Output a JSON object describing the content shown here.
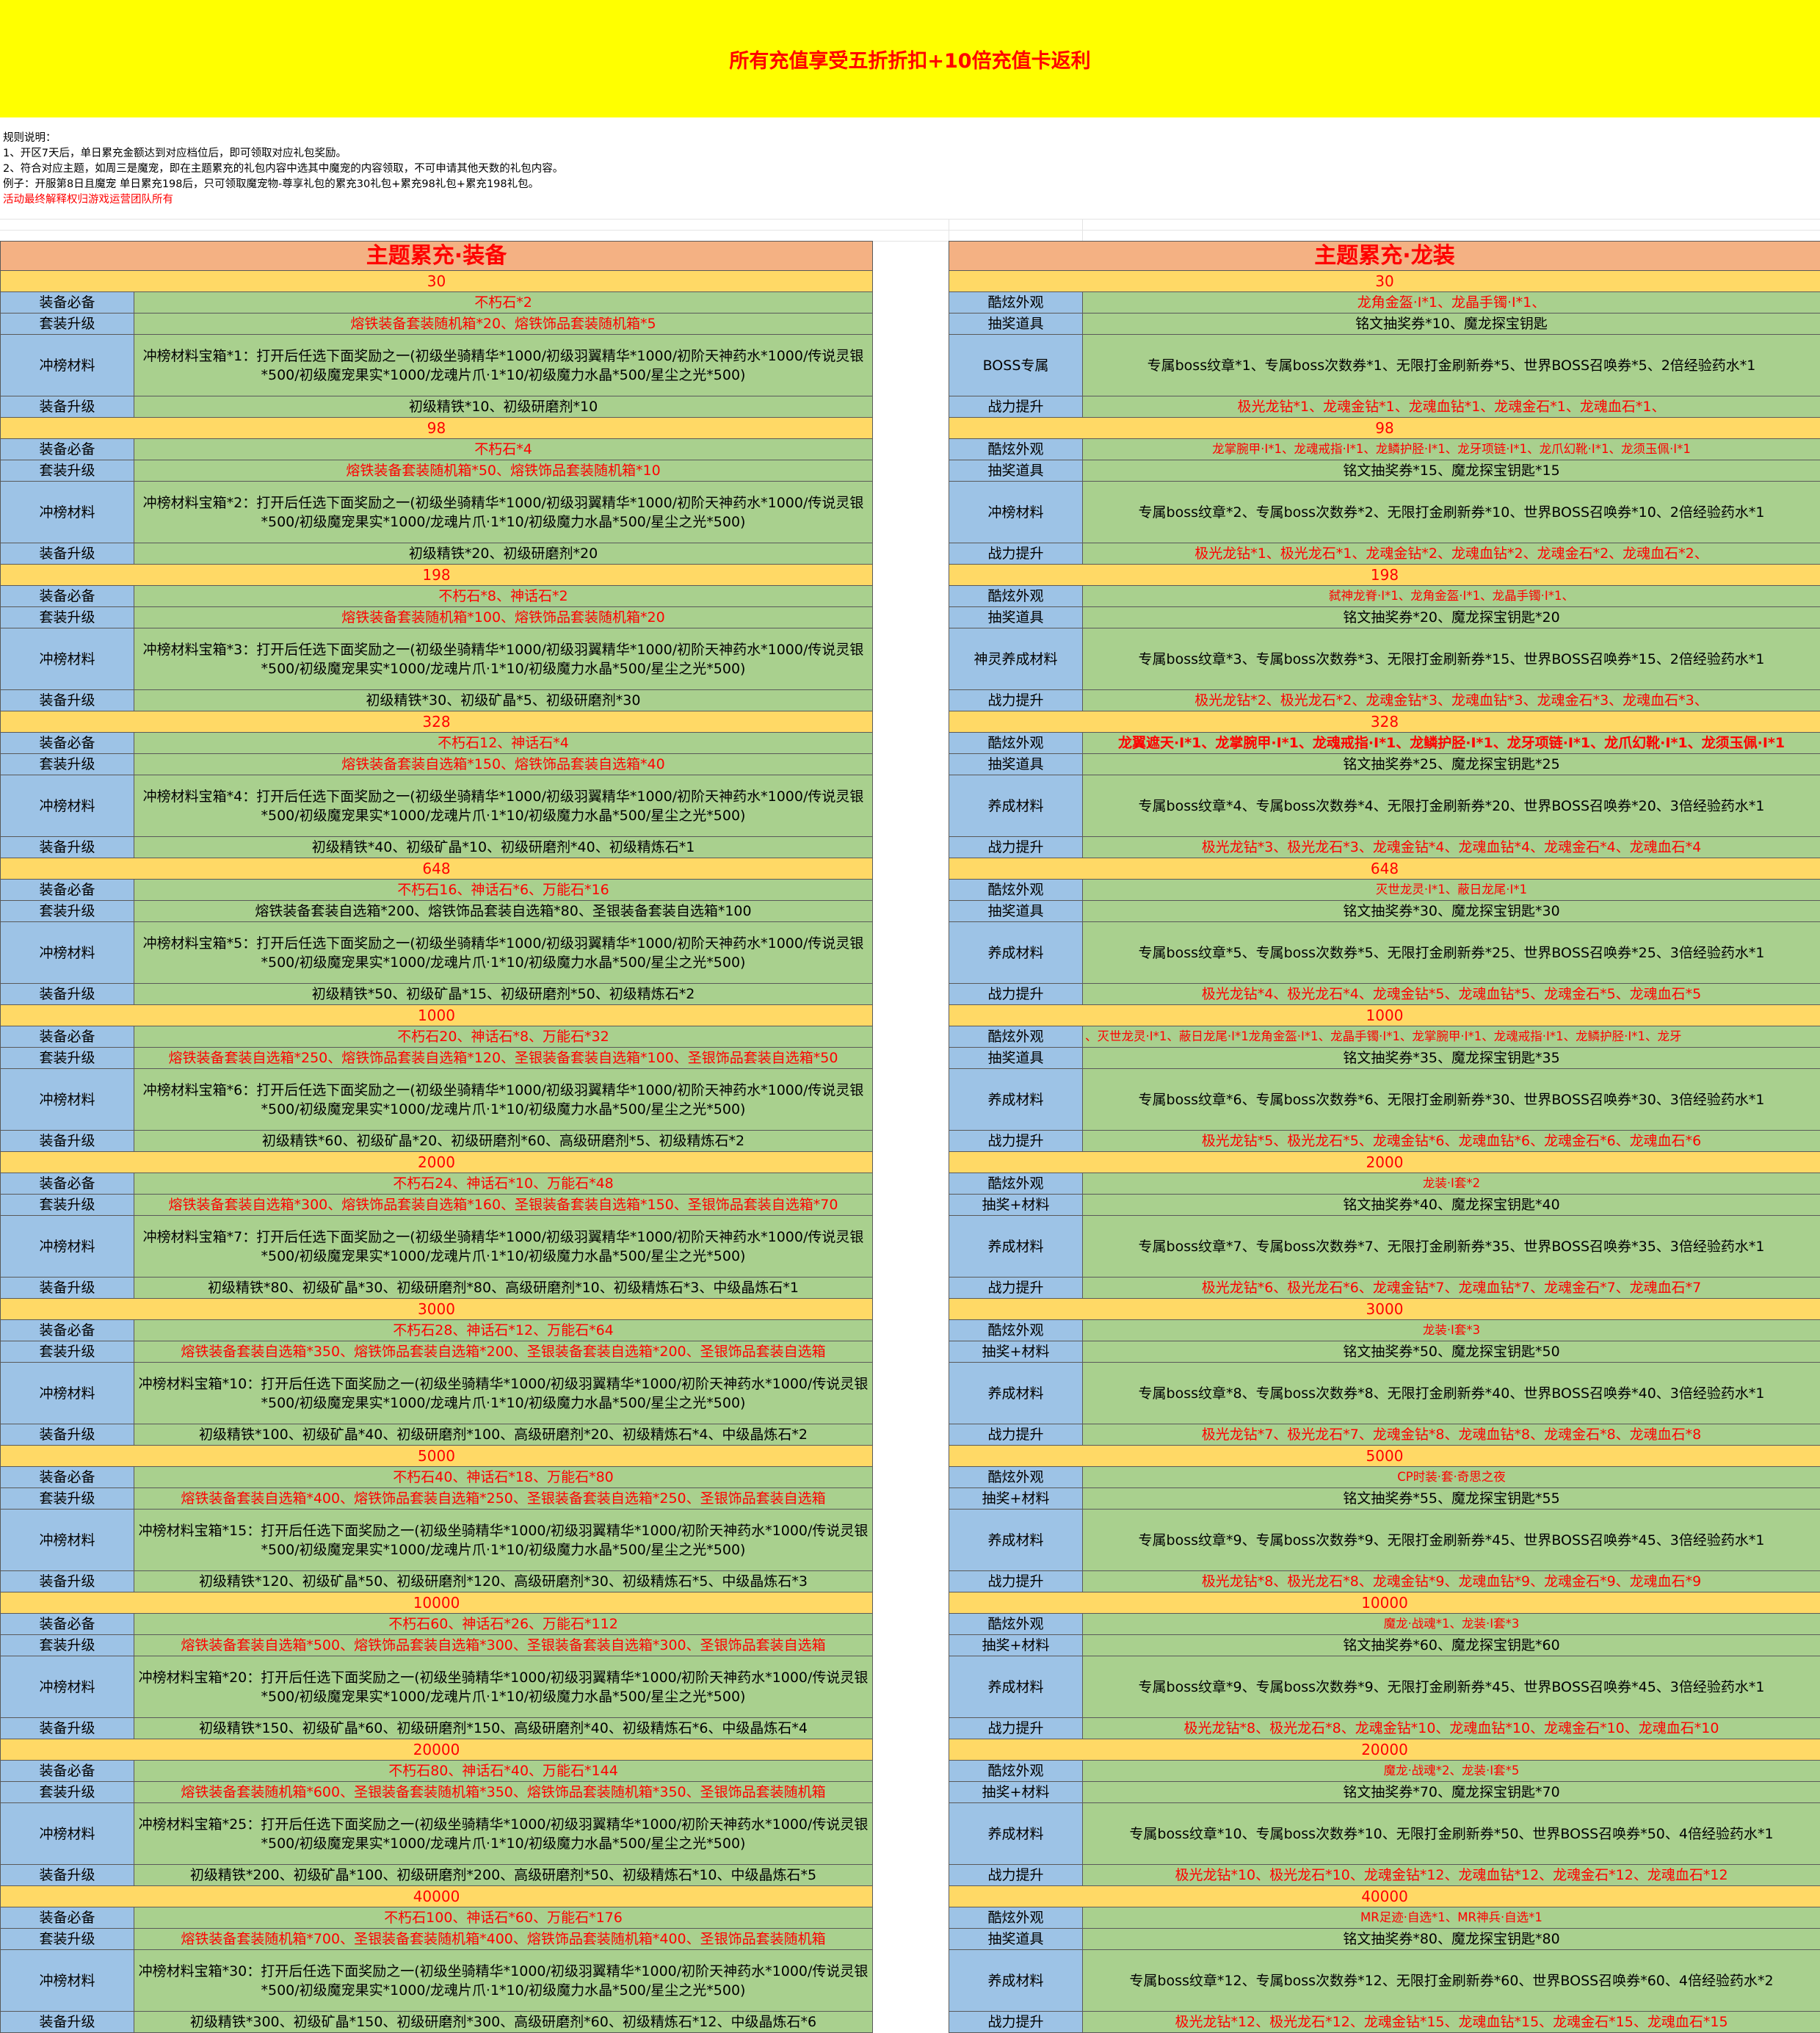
{
  "banner": "所有充值享受五折折扣+10倍充值卡返利",
  "rules": [
    {
      "text": "规则说明：",
      "red": false
    },
    {
      "text": "1、开区7天后，单日累充金额达到对应档位后，即可领取对应礼包奖励。",
      "red": false
    },
    {
      "text": "2、符合对应主题，如周三是魔宠，即在主题累充的礼包内容中选其中魔宠的内容领取，不可申请其他天数的礼包内容。",
      "red": false
    },
    {
      "text": "例子：开服第8日且魔宠 单日累充198后，只可领取魔宠物-尊享礼包的累充30礼包+累充98礼包+累充198礼包。",
      "red": false
    },
    {
      "text": "活动最终解释权归游戏运营团队所有",
      "red": true
    }
  ],
  "colors": {
    "banner_bg": "#ffff00",
    "title_bg": "#f4b183",
    "tier_bg": "#ffd966",
    "label_bg": "#9dc3e6",
    "content_bg": "#a9d08e",
    "red_text": "#ff0000"
  },
  "left": {
    "title": "主题累充·装备",
    "tiers": [
      {
        "amount": "30",
        "rows": [
          {
            "label": "装备必备",
            "text": "不朽石*2",
            "red": true
          },
          {
            "label": "套装升级",
            "text": "熔铁装备套装随机箱*20、熔铁饰品套装随机箱*5",
            "red": true
          },
          {
            "label": "冲榜材料",
            "text": "冲榜材料宝箱*1：打开后任选下面奖励之一(初级坐骑精华*1000/初级羽翼精华*1000/初阶天神药水*1000/传说灵银*500/初级魔宠果实*1000/龙魂片爪·1*10/初级魔力水晶*500/星尘之光*500)",
            "multi": true
          },
          {
            "label": "装备升级",
            "text": "初级精铁*10、初级研磨剂*10"
          }
        ]
      },
      {
        "amount": "98",
        "rows": [
          {
            "label": "装备必备",
            "text": "不朽石*4",
            "red": true
          },
          {
            "label": "套装升级",
            "text": "熔铁装备套装随机箱*50、熔铁饰品套装随机箱*10",
            "red": true
          },
          {
            "label": "冲榜材料",
            "text": "冲榜材料宝箱*2：打开后任选下面奖励之一(初级坐骑精华*1000/初级羽翼精华*1000/初阶天神药水*1000/传说灵银*500/初级魔宠果实*1000/龙魂片爪·1*10/初级魔力水晶*500/星尘之光*500)",
            "multi": true
          },
          {
            "label": "装备升级",
            "text": "初级精铁*20、初级研磨剂*20"
          }
        ]
      },
      {
        "amount": "198",
        "rows": [
          {
            "label": "装备必备",
            "text": "不朽石*8、神话石*2",
            "red": true
          },
          {
            "label": "套装升级",
            "text": "熔铁装备套装随机箱*100、熔铁饰品套装随机箱*20",
            "red": true
          },
          {
            "label": "冲榜材料",
            "text": "冲榜材料宝箱*3：打开后任选下面奖励之一(初级坐骑精华*1000/初级羽翼精华*1000/初阶天神药水*1000/传说灵银*500/初级魔宠果实*1000/龙魂片爪·1*10/初级魔力水晶*500/星尘之光*500)",
            "multi": true
          },
          {
            "label": "装备升级",
            "text": "初级精铁*30、初级矿晶*5、初级研磨剂*30"
          }
        ]
      },
      {
        "amount": "328",
        "rows": [
          {
            "label": "装备必备",
            "text": "不朽石12、神话石*4",
            "red": true
          },
          {
            "label": "套装升级",
            "text": "熔铁装备套装自选箱*150、熔铁饰品套装自选箱*40",
            "red": true
          },
          {
            "label": "冲榜材料",
            "text": "冲榜材料宝箱*4：打开后任选下面奖励之一(初级坐骑精华*1000/初级羽翼精华*1000/初阶天神药水*1000/传说灵银*500/初级魔宠果实*1000/龙魂片爪·1*10/初级魔力水晶*500/星尘之光*500)",
            "multi": true
          },
          {
            "label": "装备升级",
            "text": "初级精铁*40、初级矿晶*10、初级研磨剂*40、初级精炼石*1"
          }
        ]
      },
      {
        "amount": "648",
        "rows": [
          {
            "label": "装备必备",
            "text": "不朽石16、神话石*6、万能石*16",
            "red": true
          },
          {
            "label": "套装升级",
            "text": "熔铁装备套装自选箱*200、熔铁饰品套装自选箱*80、圣银装备套装自选箱*100"
          },
          {
            "label": "冲榜材料",
            "text": "冲榜材料宝箱*5：打开后任选下面奖励之一(初级坐骑精华*1000/初级羽翼精华*1000/初阶天神药水*1000/传说灵银*500/初级魔宠果实*1000/龙魂片爪·1*10/初级魔力水晶*500/星尘之光*500)",
            "multi": true
          },
          {
            "label": "装备升级",
            "text": "初级精铁*50、初级矿晶*15、初级研磨剂*50、初级精炼石*2"
          }
        ]
      },
      {
        "amount": "1000",
        "rows": [
          {
            "label": "装备必备",
            "text": "不朽石20、神话石*8、万能石*32",
            "red": true
          },
          {
            "label": "套装升级",
            "text": "熔铁装备套装自选箱*250、熔铁饰品套装自选箱*120、圣银装备套装自选箱*100、圣银饰品套装自选箱*50",
            "red": true
          },
          {
            "label": "冲榜材料",
            "text": "冲榜材料宝箱*6：打开后任选下面奖励之一(初级坐骑精华*1000/初级羽翼精华*1000/初阶天神药水*1000/传说灵银*500/初级魔宠果实*1000/龙魂片爪·1*10/初级魔力水晶*500/星尘之光*500)",
            "multi": true
          },
          {
            "label": "装备升级",
            "text": "初级精铁*60、初级矿晶*20、初级研磨剂*60、高级研磨剂*5、初级精炼石*2"
          }
        ]
      },
      {
        "amount": "2000",
        "rows": [
          {
            "label": "装备必备",
            "text": "不朽石24、神话石*10、万能石*48",
            "red": true
          },
          {
            "label": "套装升级",
            "text": "熔铁装备套装自选箱*300、熔铁饰品套装自选箱*160、圣银装备套装自选箱*150、圣银饰品套装自选箱*70",
            "red": true
          },
          {
            "label": "冲榜材料",
            "text": "冲榜材料宝箱*7：打开后任选下面奖励之一(初级坐骑精华*1000/初级羽翼精华*1000/初阶天神药水*1000/传说灵银*500/初级魔宠果实*1000/龙魂片爪·1*10/初级魔力水晶*500/星尘之光*500)",
            "multi": true
          },
          {
            "label": "装备升级",
            "text": "初级精铁*80、初级矿晶*30、初级研磨剂*80、高级研磨剂*10、初级精炼石*3、中级晶炼石*1"
          }
        ]
      },
      {
        "amount": "3000",
        "rows": [
          {
            "label": "装备必备",
            "text": "不朽石28、神话石*12、万能石*64",
            "red": true
          },
          {
            "label": "套装升级",
            "text": "熔铁装备套装自选箱*350、熔铁饰品套装自选箱*200、圣银装备套装自选箱*200、圣银饰品套装自选箱",
            "red": true
          },
          {
            "label": "冲榜材料",
            "text": "冲榜材料宝箱*10：打开后任选下面奖励之一(初级坐骑精华*1000/初级羽翼精华*1000/初阶天神药水*1000/传说灵银*500/初级魔宠果实*1000/龙魂片爪·1*10/初级魔力水晶*500/星尘之光*500)",
            "multi": true
          },
          {
            "label": "装备升级",
            "text": "初级精铁*100、初级矿晶*40、初级研磨剂*100、高级研磨剂*20、初级精炼石*4、中级晶炼石*2"
          }
        ]
      },
      {
        "amount": "5000",
        "rows": [
          {
            "label": "装备必备",
            "text": "不朽石40、神话石*18、万能石*80",
            "red": true
          },
          {
            "label": "套装升级",
            "text": "熔铁装备套装自选箱*400、熔铁饰品套装自选箱*250、圣银装备套装自选箱*250、圣银饰品套装自选箱",
            "red": true
          },
          {
            "label": "冲榜材料",
            "text": "冲榜材料宝箱*15：打开后任选下面奖励之一(初级坐骑精华*1000/初级羽翼精华*1000/初阶天神药水*1000/传说灵银*500/初级魔宠果实*1000/龙魂片爪·1*10/初级魔力水晶*500/星尘之光*500)",
            "multi": true
          },
          {
            "label": "装备升级",
            "text": "初级精铁*120、初级矿晶*50、初级研磨剂*120、高级研磨剂*30、初级精炼石*5、中级晶炼石*3"
          }
        ]
      },
      {
        "amount": "10000",
        "rows": [
          {
            "label": "装备必备",
            "text": "不朽石60、神话石*26、万能石*112",
            "red": true
          },
          {
            "label": "套装升级",
            "text": "熔铁装备套装自选箱*500、熔铁饰品套装自选箱*300、圣银装备套装自选箱*300、圣银饰品套装自选箱",
            "red": true
          },
          {
            "label": "冲榜材料",
            "text": "冲榜材料宝箱*20：打开后任选下面奖励之一(初级坐骑精华*1000/初级羽翼精华*1000/初阶天神药水*1000/传说灵银*500/初级魔宠果实*1000/龙魂片爪·1*10/初级魔力水晶*500/星尘之光*500)",
            "multi": true
          },
          {
            "label": "装备升级",
            "text": "初级精铁*150、初级矿晶*60、初级研磨剂*150、高级研磨剂*40、初级精炼石*6、中级晶炼石*4"
          }
        ]
      },
      {
        "amount": "20000",
        "rows": [
          {
            "label": "装备必备",
            "text": "不朽石80、神话石*40、万能石*144",
            "red": true
          },
          {
            "label": "套装升级",
            "text": "熔铁装备套装随机箱*600、圣银装备套装随机箱*350、熔铁饰品套装随机箱*350、圣银饰品套装随机箱",
            "red": true
          },
          {
            "label": "冲榜材料",
            "text": "冲榜材料宝箱*25：打开后任选下面奖励之一(初级坐骑精华*1000/初级羽翼精华*1000/初阶天神药水*1000/传说灵银*500/初级魔宠果实*1000/龙魂片爪·1*10/初级魔力水晶*500/星尘之光*500)",
            "multi": true
          },
          {
            "label": "装备升级",
            "text": "初级精铁*200、初级矿晶*100、初级研磨剂*200、高级研磨剂*50、初级精炼石*10、中级晶炼石*5"
          }
        ]
      },
      {
        "amount": "40000",
        "rows": [
          {
            "label": "装备必备",
            "text": "不朽石100、神话石*60、万能石*176",
            "red": true
          },
          {
            "label": "套装升级",
            "text": "熔铁装备套装随机箱*700、圣银装备套装随机箱*400、熔铁饰品套装随机箱*400、圣银饰品套装随机箱",
            "red": true
          },
          {
            "label": "冲榜材料",
            "text": "冲榜材料宝箱*30：打开后任选下面奖励之一(初级坐骑精华*1000/初级羽翼精华*1000/初阶天神药水*1000/传说灵银*500/初级魔宠果实*1000/龙魂片爪·1*10/初级魔力水晶*500/星尘之光*500)",
            "multi": true
          },
          {
            "label": "装备升级",
            "text": "初级精铁*300、初级矿晶*150、初级研磨剂*300、高级研磨剂*60、初级精炼石*12、中级晶炼石*6"
          }
        ]
      }
    ]
  },
  "right": {
    "title": "主题累充·龙装",
    "tiers": [
      {
        "amount": "30",
        "rows": [
          {
            "label": "酷炫外观",
            "text": "龙角金盔·Ⅰ*1、龙晶手镯·Ⅰ*1、",
            "red": true
          },
          {
            "label": "抽奖道具",
            "text": "铭文抽奖券*10、魔龙探宝钥匙"
          },
          {
            "label": "BOSS专属",
            "text": "专属boss纹章*1、专属boss次数券*1、无限打金刷新券*5、世界BOSS召唤券*5、2倍经验药水*1",
            "big": true
          },
          {
            "label": "战力提升",
            "text": "极光龙钻*1、龙魂金钻*1、龙魂血钻*1、龙魂金石*1、龙魂血石*1、",
            "red": true
          }
        ]
      },
      {
        "amount": "98",
        "rows": [
          {
            "label": "酷炫外观",
            "text": "龙掌腕甲·Ⅰ*1、龙魂戒指·Ⅰ*1、龙鳞护胫·Ⅰ*1、龙牙项链·Ⅰ*1、龙爪幻靴·Ⅰ*1、龙须玉佩·Ⅰ*1",
            "red": true,
            "sm": true
          },
          {
            "label": "抽奖道具",
            "text": "铭文抽奖券*15、魔龙探宝钥匙*15"
          },
          {
            "label": "冲榜材料",
            "text": "专属boss纹章*2、专属boss次数券*2、无限打金刷新券*10、世界BOSS召唤券*10、2倍经验药水*1",
            "big": true
          },
          {
            "label": "战力提升",
            "text": "极光龙钻*1、极光龙石*1、龙魂金钻*2、龙魂血钻*2、龙魂金石*2、龙魂血石*2、",
            "red": true
          }
        ]
      },
      {
        "amount": "198",
        "rows": [
          {
            "label": "酷炫外观",
            "text": "弑神龙脊·Ⅰ*1、龙角金盔·Ⅰ*1、龙晶手镯·Ⅰ*1、",
            "red": true,
            "sm": true
          },
          {
            "label": "抽奖道具",
            "text": "铭文抽奖券*20、魔龙探宝钥匙*20"
          },
          {
            "label": "神灵养成材料",
            "text": "专属boss纹章*3、专属boss次数券*3、无限打金刷新券*15、世界BOSS召唤券*15、2倍经验药水*1",
            "big": true
          },
          {
            "label": "战力提升",
            "text": "极光龙钻*2、极光龙石*2、龙魂金钻*3、龙魂血钻*3、龙魂金石*3、龙魂血石*3、",
            "red": true
          }
        ]
      },
      {
        "amount": "328",
        "rows": [
          {
            "label": "酷炫外观",
            "text": "龙翼遮天·Ⅰ*1、龙掌腕甲·Ⅰ*1、龙魂戒指·Ⅰ*1、龙鳞护胫·Ⅰ*1、龙牙项链·Ⅰ*1、龙爪幻靴·Ⅰ*1、龙须玉佩·Ⅰ*1",
            "red": true,
            "bold": true
          },
          {
            "label": "抽奖道具",
            "text": "铭文抽奖券*25、魔龙探宝钥匙*25"
          },
          {
            "label": "养成材料",
            "text": "专属boss纹章*4、专属boss次数券*4、无限打金刷新券*20、世界BOSS召唤券*20、3倍经验药水*1",
            "big": true
          },
          {
            "label": "战力提升",
            "text": "极光龙钻*3、极光龙石*3、龙魂金钻*4、龙魂血钻*4、龙魂金石*4、龙魂血石*4",
            "red": true
          }
        ]
      },
      {
        "amount": "648",
        "rows": [
          {
            "label": "酷炫外观",
            "text": "灭世龙灵·Ⅰ*1、蔽日龙尾·Ⅰ*1",
            "red": true,
            "sm": true
          },
          {
            "label": "抽奖道具",
            "text": "铭文抽奖券*30、魔龙探宝钥匙*30"
          },
          {
            "label": "养成材料",
            "text": "专属boss纹章*5、专属boss次数券*5、无限打金刷新券*25、世界BOSS召唤券*25、3倍经验药水*1",
            "big": true
          },
          {
            "label": "战力提升",
            "text": "极光龙钻*4、极光龙石*4、龙魂金钻*5、龙魂血钻*5、龙魂金石*5、龙魂血石*5",
            "red": true
          }
        ]
      },
      {
        "amount": "1000",
        "rows": [
          {
            "label": "酷炫外观",
            "text": "、灭世龙灵·Ⅰ*1、蔽日龙尾·Ⅰ*1龙角金盔·Ⅰ*1、龙晶手镯·Ⅰ*1、龙掌腕甲·Ⅰ*1、龙魂戒指·Ⅰ*1、龙鳞护胫·Ⅰ*1、龙牙",
            "red": true,
            "sm": true,
            "left": true
          },
          {
            "label": "抽奖道具",
            "text": "铭文抽奖券*35、魔龙探宝钥匙*35"
          },
          {
            "label": "养成材料",
            "text": "专属boss纹章*6、专属boss次数券*6、无限打金刷新券*30、世界BOSS召唤券*30、3倍经验药水*1",
            "big": true
          },
          {
            "label": "战力提升",
            "text": "极光龙钻*5、极光龙石*5、龙魂金钻*6、龙魂血钻*6、龙魂金石*6、龙魂血石*6",
            "red": true
          }
        ]
      },
      {
        "amount": "2000",
        "rows": [
          {
            "label": "酷炫外观",
            "text": "龙装·Ⅰ套*2",
            "red": true,
            "sm": true
          },
          {
            "label": "抽奖+材料",
            "text": "铭文抽奖券*40、魔龙探宝钥匙*40"
          },
          {
            "label": "养成材料",
            "text": "专属boss纹章*7、专属boss次数券*7、无限打金刷新券*35、世界BOSS召唤券*35、3倍经验药水*1",
            "big": true
          },
          {
            "label": "战力提升",
            "text": "极光龙钻*6、极光龙石*6、龙魂金钻*7、龙魂血钻*7、龙魂金石*7、龙魂血石*7",
            "red": true
          }
        ]
      },
      {
        "amount": "3000",
        "rows": [
          {
            "label": "酷炫外观",
            "text": "龙装·Ⅰ套*3",
            "red": true,
            "sm": true
          },
          {
            "label": "抽奖+材料",
            "text": "铭文抽奖券*50、魔龙探宝钥匙*50"
          },
          {
            "label": "养成材料",
            "text": "专属boss纹章*8、专属boss次数券*8、无限打金刷新券*40、世界BOSS召唤券*40、3倍经验药水*1",
            "big": true
          },
          {
            "label": "战力提升",
            "text": "极光龙钻*7、极光龙石*7、龙魂金钻*8、龙魂血钻*8、龙魂金石*8、龙魂血石*8",
            "red": true
          }
        ]
      },
      {
        "amount": "5000",
        "rows": [
          {
            "label": "酷炫外观",
            "text": "CP时装·套·奇思之夜",
            "red": true,
            "sm": true
          },
          {
            "label": "抽奖+材料",
            "text": "铭文抽奖券*55、魔龙探宝钥匙*55"
          },
          {
            "label": "养成材料",
            "text": "专属boss纹章*9、专属boss次数券*9、无限打金刷新券*45、世界BOSS召唤券*45、3倍经验药水*1",
            "big": true
          },
          {
            "label": "战力提升",
            "text": "极光龙钻*8、极光龙石*8、龙魂金钻*9、龙魂血钻*9、龙魂金石*9、龙魂血石*9",
            "red": true
          }
        ]
      },
      {
        "amount": "10000",
        "rows": [
          {
            "label": "酷炫外观",
            "text": "魔龙·战魂*1、龙装·Ⅰ套*3",
            "red": true,
            "sm": true
          },
          {
            "label": "抽奖+材料",
            "text": "铭文抽奖券*60、魔龙探宝钥匙*60"
          },
          {
            "label": "养成材料",
            "text": "专属boss纹章*9、专属boss次数券*9、无限打金刷新券*45、世界BOSS召唤券*45、3倍经验药水*1",
            "big": true
          },
          {
            "label": "战力提升",
            "text": "极光龙钻*8、极光龙石*8、龙魂金钻*10、龙魂血钻*10、龙魂金石*10、龙魂血石*10",
            "red": true
          }
        ]
      },
      {
        "amount": "20000",
        "rows": [
          {
            "label": "酷炫外观",
            "text": "魔龙·战魂*2、龙装·Ⅰ套*5",
            "red": true,
            "sm": true
          },
          {
            "label": "抽奖+材料",
            "text": "铭文抽奖券*70、魔龙探宝钥匙*70"
          },
          {
            "label": "养成材料",
            "text": "专属boss纹章*10、专属boss次数券*10、无限打金刷新券*50、世界BOSS召唤券*50、4倍经验药水*1",
            "big": true
          },
          {
            "label": "战力提升",
            "text": "极光龙钻*10、极光龙石*10、龙魂金钻*12、龙魂血钻*12、龙魂金石*12、龙魂血石*12",
            "red": true
          }
        ]
      },
      {
        "amount": "40000",
        "rows": [
          {
            "label": "酷炫外观",
            "text": "MR足迹·自选*1、MR神兵·自选*1",
            "red": true,
            "sm": true
          },
          {
            "label": "抽奖道具",
            "text": "铭文抽奖券*80、魔龙探宝钥匙*80"
          },
          {
            "label": "养成材料",
            "text": "专属boss纹章*12、专属boss次数券*12、无限打金刷新券*60、世界BOSS召唤券*60、4倍经验药水*2",
            "big": true
          },
          {
            "label": "战力提升",
            "text": "极光龙钻*12、极光龙石*12、龙魂金钻*15、龙魂血钻*15、龙魂金石*15、龙魂血石*15",
            "red": true
          }
        ]
      }
    ]
  }
}
